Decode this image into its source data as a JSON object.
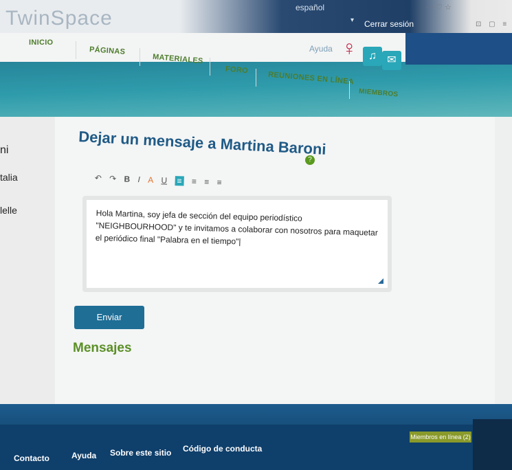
{
  "header": {
    "brand": "TwinSpace",
    "language": "español",
    "logout": "Cerrar sesión",
    "help": "Ayuda"
  },
  "nav": {
    "items": [
      "INICIO",
      "PÁGINAS",
      "MATERIALES",
      "FORO",
      "REUNIONES EN LÍNEA",
      "MIEMBROS"
    ]
  },
  "sidebar": {
    "labels": [
      "ni",
      "talia",
      "lelle"
    ]
  },
  "compose": {
    "title": "Dejar un mensaje a Martina Baroni",
    "message": "Hola Martina, soy jefa de sección del equipo periodístico \"NEIGHBOURHOOD\" y te invitamos a colaborar con nosotros para maquetar el periódico final \"Palabra en el tiempo\"|",
    "send_label": "Enviar",
    "toolbar": [
      "↶",
      "↷",
      "B",
      "I",
      "A",
      "U",
      "≡",
      "≡",
      "≡",
      "≡"
    ]
  },
  "messages": {
    "title": "Mensajes"
  },
  "footer": {
    "links": [
      "Contacto",
      "Ayuda",
      "Sobre este sitio",
      "Código de conducta"
    ],
    "online": "Miembros en línea (2)"
  },
  "colors": {
    "brand_blue": "#1e4f86",
    "teal": "#2aa7b8",
    "green": "#5b8f27",
    "title_blue": "#1f5a86"
  }
}
